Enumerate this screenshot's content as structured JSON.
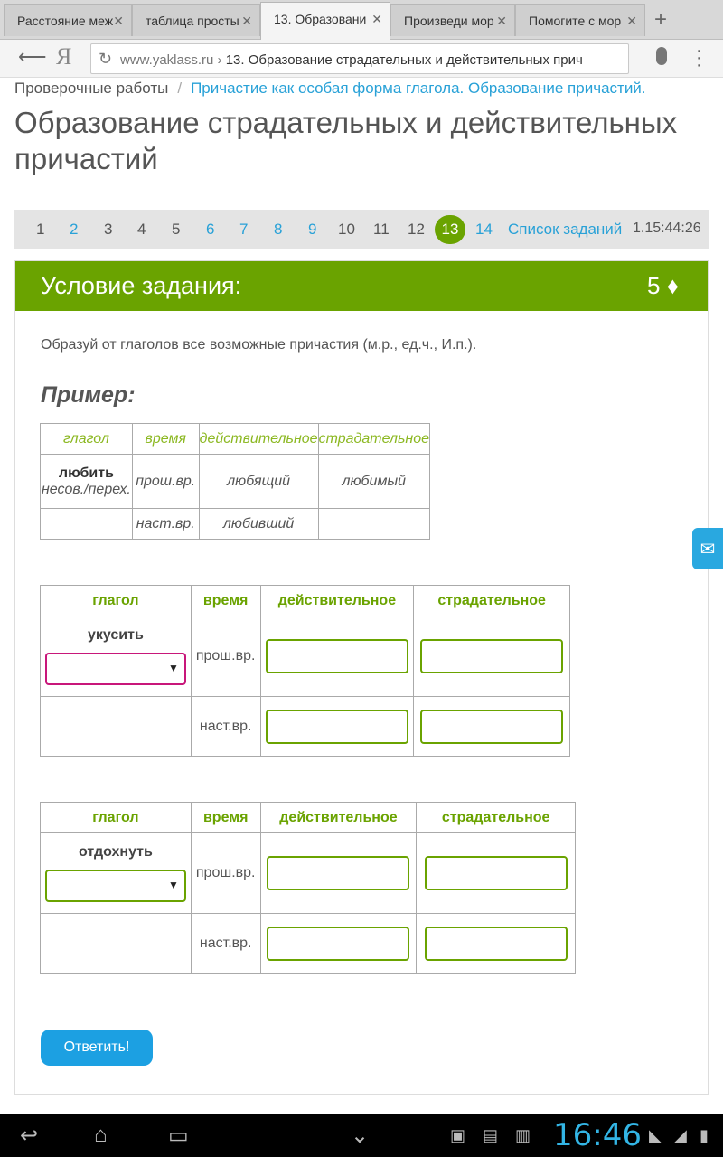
{
  "browser": {
    "tabs": [
      {
        "label": "Расстояние меж",
        "active": false
      },
      {
        "label": "таблица просты",
        "active": false
      },
      {
        "label": "13. Образовани",
        "active": true
      },
      {
        "label": "Произведи мор",
        "active": false
      },
      {
        "label": "Помогите с мор",
        "active": false
      }
    ],
    "new_tab_icon": "plus-icon",
    "url_host": "www.yaklass.ru",
    "url_sep": "›",
    "url_title": "13. Образование страдательных и действительных прич",
    "search_logo": "Я"
  },
  "breadcrumbs": {
    "first": "Проверочные работы",
    "sep": "/",
    "second": "Причастие как особая форма глагола. Образование причастий."
  },
  "page_title": "Образование страдательных и действительных причастий",
  "pager": {
    "pages": [
      "1",
      "2",
      "3",
      "4",
      "5",
      "6",
      "7",
      "8",
      "9",
      "10",
      "11",
      "12",
      "13",
      "14"
    ],
    "current": "13",
    "linked": [
      "2",
      "6",
      "7",
      "8",
      "9",
      "14"
    ],
    "list_label": "Список заданий",
    "timer": "1.15:44:26"
  },
  "task": {
    "header": "Условие задания:",
    "points": "5",
    "points_icon": "diamond-icon",
    "instruction": "Образуй от глаголов все возможные причастия (м.р., ед.ч., И.п.).",
    "example_title": "Пример:",
    "example": {
      "headers": [
        "глагол",
        "время",
        "действительное",
        "страдательное"
      ],
      "verb": "любить",
      "verb_note": "несов./перех.",
      "row1": {
        "tense": "прош.вр.",
        "active": "любящий",
        "passive": "любимый"
      },
      "row2": {
        "tense": "наст.вр.",
        "active": "любивший",
        "passive": ""
      }
    },
    "questions": [
      {
        "headers": [
          "глагол",
          "время",
          "действительное",
          "страдательное"
        ],
        "verb": "укусить",
        "tense1": "прош.вр.",
        "tense2": "наст.вр.",
        "select_value": ""
      },
      {
        "headers": [
          "глагол",
          "время",
          "действительное",
          "страдательное"
        ],
        "verb": "отдохнуть",
        "tense1": "прош.вр.",
        "tense2": "наст.вр.",
        "select_value": ""
      }
    ],
    "submit_label": "Ответить!"
  },
  "system": {
    "clock": "16:46"
  },
  "colors": {
    "accent_green": "#6aa300",
    "link_blue": "#28a1d7",
    "button_blue": "#1ca0e2",
    "focus_pink": "#c8177a"
  }
}
